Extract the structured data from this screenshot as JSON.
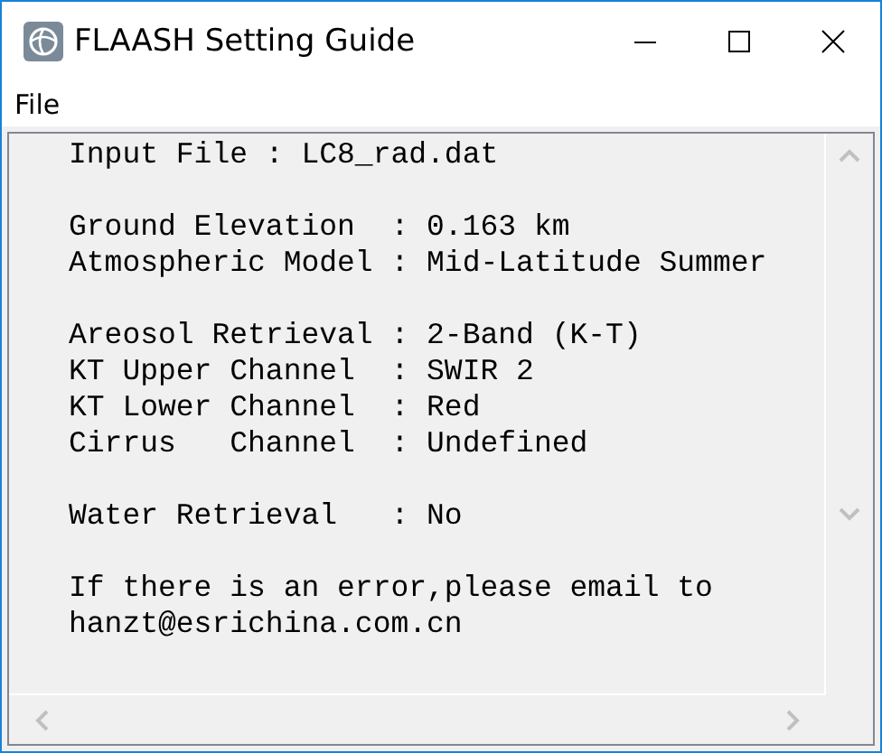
{
  "window": {
    "title": "FLAASH Setting Guide"
  },
  "menu": [
    "File"
  ],
  "text_groups": [
    [
      "Input File : LC8_rad.dat"
    ],
    [
      "Ground Elevation  : 0.163 km",
      "Atmospheric Model : Mid-Latitude Summer"
    ],
    [
      "Areosol Retrieval : 2-Band (K-T)",
      "KT Upper Channel  : SWIR 2",
      "KT Lower Channel  : Red",
      "Cirrus   Channel  : Undefined"
    ],
    [
      "Water Retrieval   : No"
    ],
    [
      "If there is an error,please email to",
      "hanzt@esrichina.com.cn"
    ]
  ]
}
